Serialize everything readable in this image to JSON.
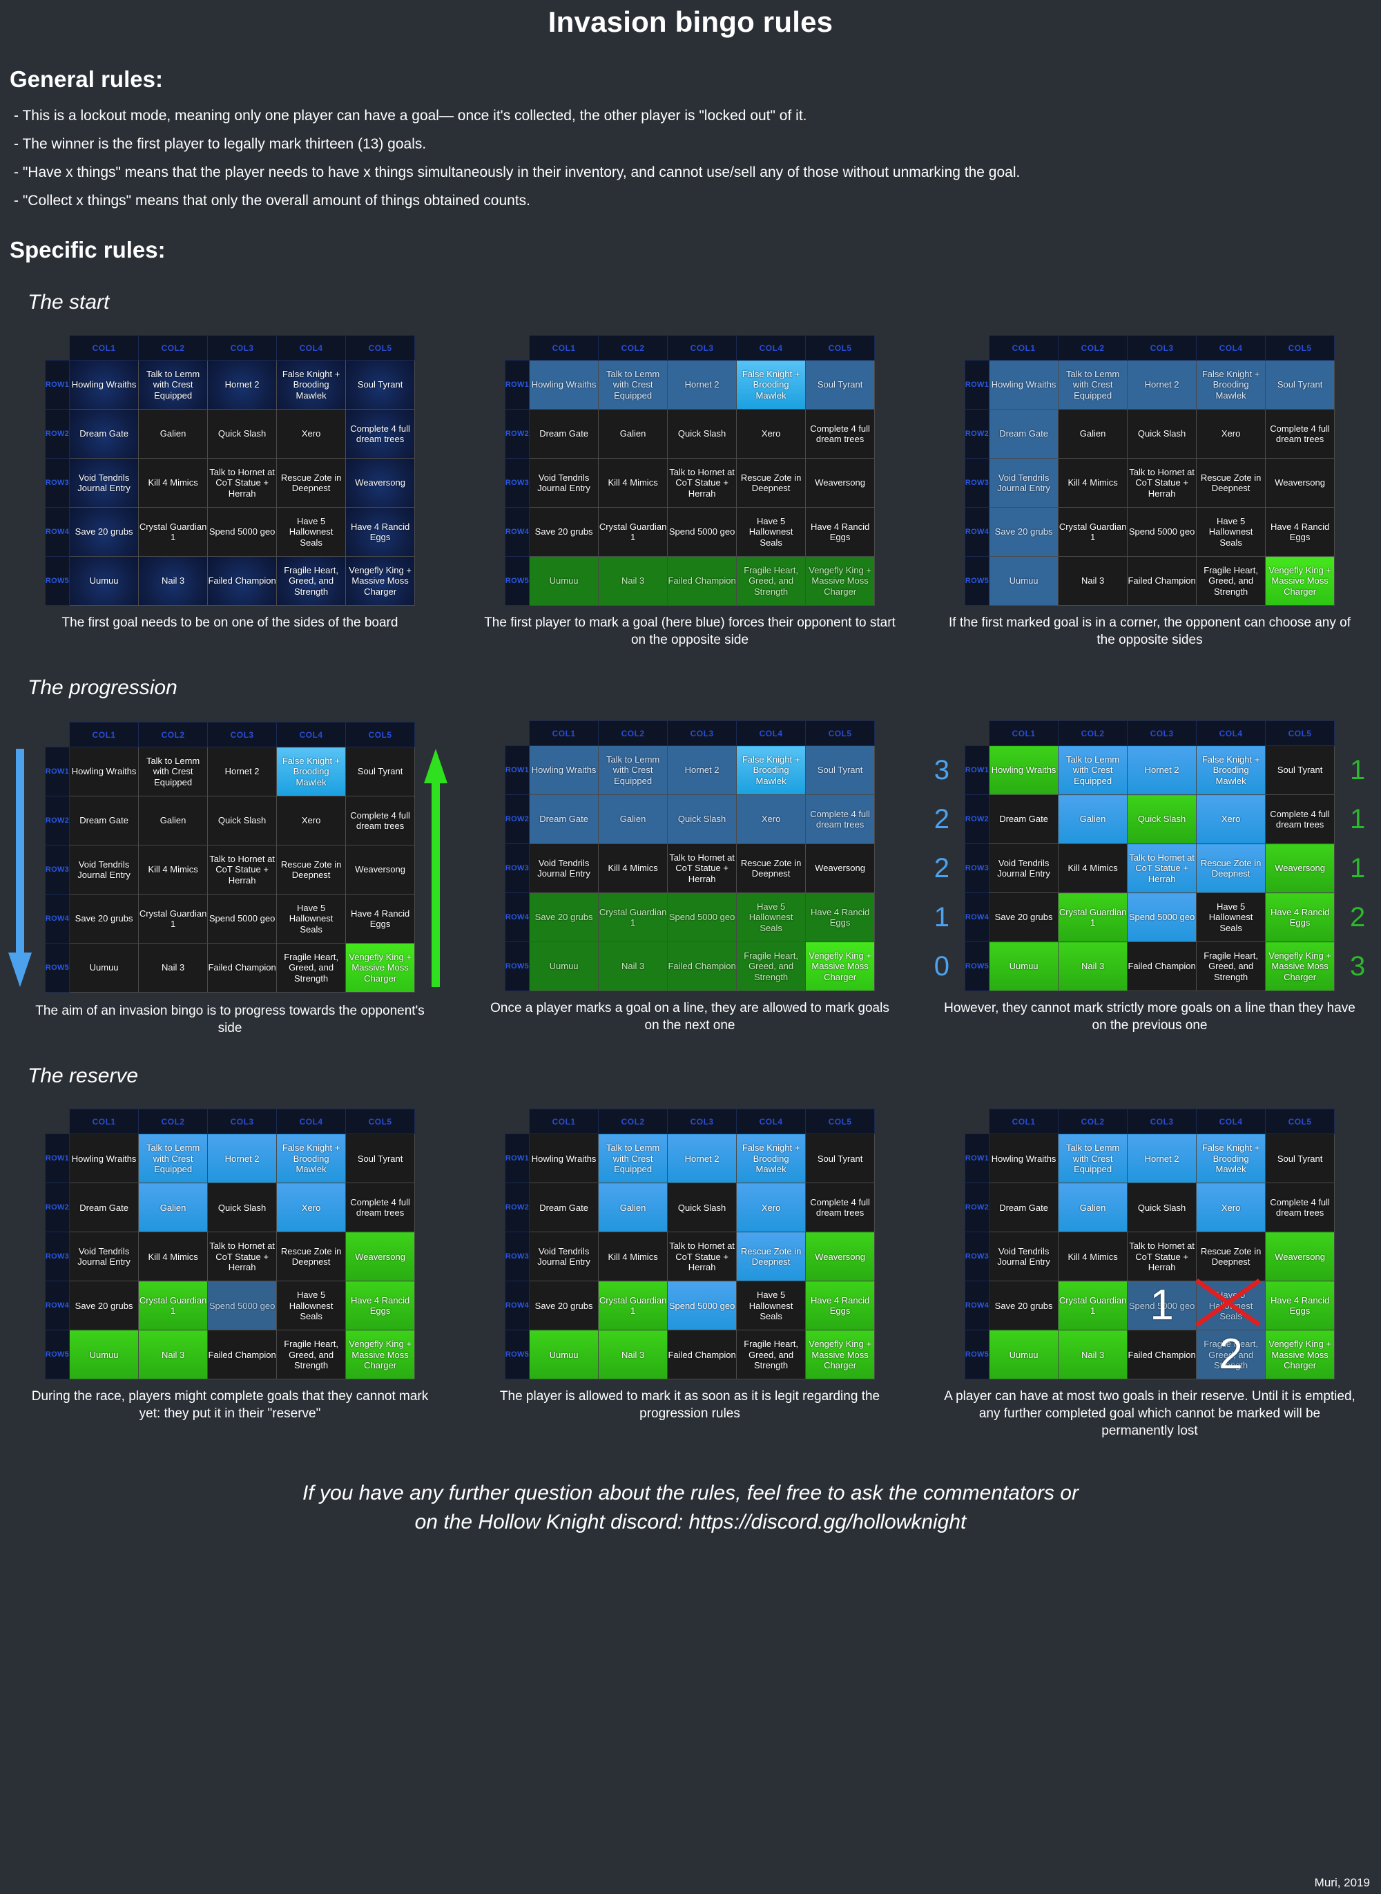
{
  "title": "Invasion bingo rules",
  "general": {
    "heading": "General rules:",
    "items": [
      "- This is a lockout mode, meaning only one player can have a goal— once it's collected, the other player is \"locked out\" of it.",
      "- The winner is the first player to legally mark thirteen (13) goals.",
      "- \"Have x things\" means that the player needs to have x things simultaneously in their inventory, and cannot use/sell any of those without unmarking the goal.",
      "- \"Collect x things\" means that only the overall amount of things obtained counts."
    ]
  },
  "specific": {
    "heading": "Specific rules:"
  },
  "sections": [
    {
      "heading": "The start"
    },
    {
      "heading": "The progression"
    },
    {
      "heading": "The reserve"
    }
  ],
  "grid": {
    "col_headers": [
      "COL1",
      "COL2",
      "COL3",
      "COL4",
      "COL5"
    ],
    "row_headers": [
      "ROW1",
      "ROW2",
      "ROW3",
      "ROW4",
      "ROW5"
    ],
    "goals": [
      [
        "Howling Wraiths",
        "Talk to Lemm with Crest Equipped",
        "Hornet 2",
        "False Knight + Brooding Mawlek",
        "Soul Tyrant"
      ],
      [
        "Dream Gate",
        "Galien",
        "Quick Slash",
        "Xero",
        "Complete 4 full dream trees"
      ],
      [
        "Void Tendrils Journal Entry",
        "Kill 4 Mimics",
        "Talk to Hornet at CoT Statue + Herrah",
        "Rescue Zote in Deepnest",
        "Weaversong"
      ],
      [
        "Save 20 grubs",
        "Crystal Guardian 1",
        "Spend 5000 geo",
        "Have 5 Hallownest Seals",
        "Have 4 Rancid Eggs"
      ],
      [
        "Uumuu",
        "Nail 3",
        "Failed Champion",
        "Fragile Heart, Greed, and Strength",
        "Vengefly King + Massive Moss Charger"
      ]
    ]
  },
  "colors": {
    "background": "#2b2f36",
    "header_bg": "#0d1426",
    "header_text": "#2a4cd6",
    "cell_dark": "#1b1b1b",
    "side_dark_blue": "#17326e",
    "side_mid_blue": "#336699",
    "marked_blue": "#2196dd",
    "marked_blue_bright": "#1ba0e0",
    "side_dark_green": "#1a7d16",
    "marked_green": "#29ad12",
    "marked_green_bright": "#2fc414",
    "reserve_blue": "#33628f",
    "lost_x_red": "#e02020",
    "left_number": "#4da2ee",
    "right_number": "#2cb82c",
    "arrow_blue": "#4da2ee",
    "arrow_green": "#2ee01e"
  },
  "boards": [
    {
      "id": "board-start-1",
      "caption": "The first goal needs to be on one of the sides of the board",
      "left_arrow": null,
      "right_arrow": null,
      "left_numbers": null,
      "right_numbers": null,
      "states": [
        [
          "sidedark",
          "sidedark",
          "sidedark",
          "sidedark",
          "sidedark"
        ],
        [
          "sidedark",
          "dark",
          "dark",
          "dark",
          "sidedark"
        ],
        [
          "sidedark",
          "dark",
          "dark",
          "dark",
          "sidedark"
        ],
        [
          "sidedark",
          "dark",
          "dark",
          "dark",
          "sidedark"
        ],
        [
          "sidedark",
          "sidedark",
          "sidedark",
          "sidedark",
          "sidedark"
        ]
      ],
      "overlays": []
    },
    {
      "id": "board-start-2",
      "caption": "The first player to mark a goal (here blue) forces their opponent to start on the opposite side",
      "left_arrow": null,
      "right_arrow": null,
      "left_numbers": null,
      "right_numbers": null,
      "states": [
        [
          "sidemid",
          "sidemid",
          "sidemid",
          "bluebright",
          "sidemid"
        ],
        [
          "dark",
          "dark",
          "dark",
          "dark",
          "dark"
        ],
        [
          "dark",
          "dark",
          "dark",
          "dark",
          "dark"
        ],
        [
          "dark",
          "dark",
          "dark",
          "dark",
          "dark"
        ],
        [
          "greendark",
          "greendark",
          "greendark",
          "greendark",
          "greendark"
        ]
      ],
      "overlays": []
    },
    {
      "id": "board-start-3",
      "caption": "If the first marked goal is in a corner, the opponent can choose any of the opposite sides",
      "left_arrow": null,
      "right_arrow": null,
      "left_numbers": null,
      "right_numbers": null,
      "states": [
        [
          "sidemid",
          "sidemid",
          "sidemid",
          "sidemid",
          "sidemid"
        ],
        [
          "sidemid",
          "dark",
          "dark",
          "dark",
          "dark"
        ],
        [
          "sidemid",
          "dark",
          "dark",
          "dark",
          "dark"
        ],
        [
          "sidemid",
          "dark",
          "dark",
          "dark",
          "dark"
        ],
        [
          "sidemid",
          "dark",
          "dark",
          "dark",
          "greenbright"
        ]
      ],
      "overlays": []
    },
    {
      "id": "board-progression-1",
      "caption": "The aim of an invasion bingo is to progress towards the opponent's side",
      "left_arrow": "down",
      "right_arrow": "up",
      "left_numbers": null,
      "right_numbers": null,
      "states": [
        [
          "dark",
          "dark",
          "dark",
          "bluebright",
          "dark"
        ],
        [
          "dark",
          "dark",
          "dark",
          "dark",
          "dark"
        ],
        [
          "dark",
          "dark",
          "dark",
          "dark",
          "dark"
        ],
        [
          "dark",
          "dark",
          "dark",
          "dark",
          "dark"
        ],
        [
          "dark",
          "dark",
          "dark",
          "dark",
          "greenbright"
        ]
      ],
      "overlays": []
    },
    {
      "id": "board-progression-2",
      "caption": "Once a player marks a goal on a line, they are allowed to mark goals on the next one",
      "left_arrow": null,
      "right_arrow": null,
      "left_numbers": null,
      "right_numbers": null,
      "states": [
        [
          "sidemid",
          "sidemid",
          "sidemid",
          "bluebright",
          "sidemid"
        ],
        [
          "sidemid",
          "sidemid",
          "sidemid",
          "sidemid",
          "sidemid"
        ],
        [
          "dark",
          "dark",
          "dark",
          "dark",
          "dark"
        ],
        [
          "greendark",
          "greendark",
          "greendark",
          "greendark",
          "greendark"
        ],
        [
          "greendark",
          "greendark",
          "greendark",
          "greendark",
          "greenbright"
        ]
      ],
      "overlays": []
    },
    {
      "id": "board-progression-3",
      "caption": "However, they cannot mark strictly more goals on a line than they have on the previous one",
      "left_arrow": null,
      "right_arrow": null,
      "left_numbers": [
        "3",
        "2",
        "2",
        "1",
        "0"
      ],
      "right_numbers": [
        "1",
        "1",
        "1",
        "2",
        "3"
      ],
      "states": [
        [
          "green",
          "blue",
          "blue",
          "blue",
          "dark"
        ],
        [
          "dark",
          "blue",
          "green",
          "blue",
          "dark"
        ],
        [
          "dark",
          "dark",
          "blue",
          "blue",
          "green"
        ],
        [
          "dark",
          "green",
          "blue",
          "dark",
          "green"
        ],
        [
          "green",
          "green",
          "dark",
          "dark",
          "green"
        ]
      ],
      "overlays": []
    },
    {
      "id": "board-reserve-1",
      "caption": "During the race, players might complete goals that they cannot mark yet: they put it in their \"reserve\"",
      "left_arrow": null,
      "right_arrow": null,
      "left_numbers": null,
      "right_numbers": null,
      "states": [
        [
          "dark",
          "blue",
          "blue",
          "blue",
          "dark"
        ],
        [
          "dark",
          "blue",
          "dark",
          "blue",
          "dark"
        ],
        [
          "dark",
          "dark",
          "dark",
          "dark",
          "green"
        ],
        [
          "dark",
          "green",
          "reserve",
          "dark",
          "green"
        ],
        [
          "green",
          "green",
          "dark",
          "dark",
          "green"
        ]
      ],
      "overlays": []
    },
    {
      "id": "board-reserve-2",
      "caption": "The player is allowed to mark it as soon as it is legit regarding the progression rules",
      "left_arrow": null,
      "right_arrow": null,
      "left_numbers": null,
      "right_numbers": null,
      "states": [
        [
          "dark",
          "blue",
          "blue",
          "blue",
          "dark"
        ],
        [
          "dark",
          "blue",
          "dark",
          "blue",
          "dark"
        ],
        [
          "dark",
          "dark",
          "dark",
          "blue",
          "green"
        ],
        [
          "dark",
          "green",
          "blue",
          "dark",
          "green"
        ],
        [
          "green",
          "green",
          "dark",
          "dark",
          "green"
        ]
      ],
      "overlays": []
    },
    {
      "id": "board-reserve-3",
      "caption": "A player can have at most two goals in their reserve. Until it is emptied, any further completed goal which cannot be marked will be permanently lost",
      "left_arrow": null,
      "right_arrow": null,
      "left_numbers": null,
      "right_numbers": null,
      "states": [
        [
          "dark",
          "blue",
          "blue",
          "blue",
          "dark"
        ],
        [
          "dark",
          "blue",
          "dark",
          "blue",
          "dark"
        ],
        [
          "dark",
          "dark",
          "dark",
          "dark",
          "green"
        ],
        [
          "dark",
          "green",
          "reserve",
          "reserve",
          "green"
        ],
        [
          "green",
          "green",
          "dark",
          "reserve",
          "green"
        ]
      ],
      "overlays": [
        {
          "row": 3,
          "col": 2,
          "kind": "number",
          "text": "1"
        },
        {
          "row": 3,
          "col": 3,
          "kind": "cross",
          "text": ""
        },
        {
          "row": 4,
          "col": 3,
          "kind": "number",
          "text": "2"
        }
      ]
    }
  ],
  "footer": {
    "line1": "If you have any further question about the rules, feel free to ask the commentators or",
    "line2": "on the Hollow Knight discord: https://discord.gg/hollowknight",
    "signature": "Muri, 2019"
  }
}
